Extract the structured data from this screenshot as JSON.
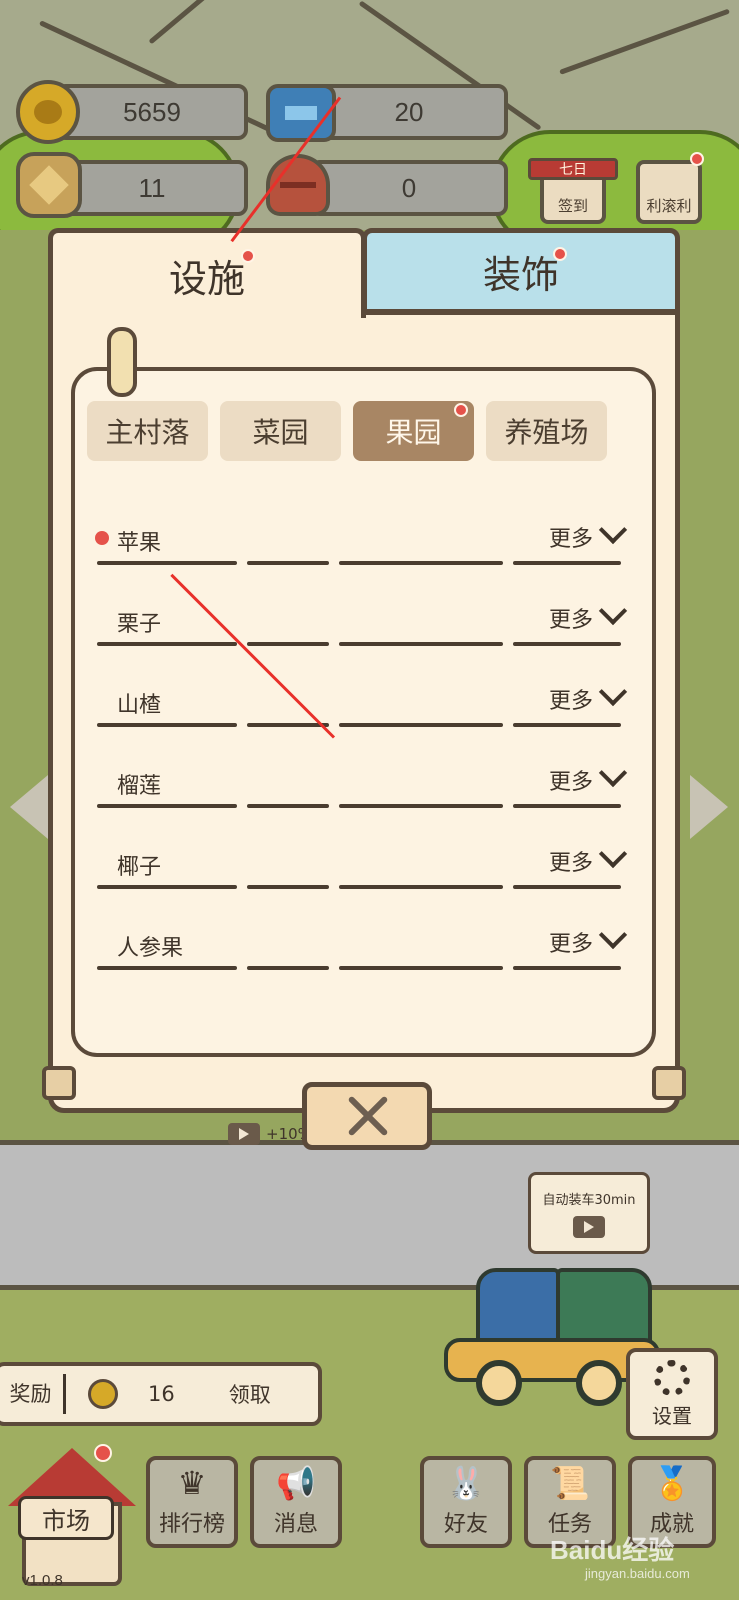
{
  "resources": {
    "coins": "5659",
    "gems": "20",
    "stars": "11",
    "shells": "0"
  },
  "side_buttons": {
    "checkin_top": "七日",
    "checkin": "签到",
    "rolling": "利滚利"
  },
  "dialog": {
    "tabs": [
      {
        "label": "设施",
        "active": true,
        "has_notice": true
      },
      {
        "label": "装饰",
        "active": false,
        "has_notice": true
      }
    ],
    "sub_tabs": [
      {
        "label": "主村落",
        "active": false
      },
      {
        "label": "菜园",
        "active": false
      },
      {
        "label": "果园",
        "active": true,
        "has_notice": true
      },
      {
        "label": "养殖场",
        "active": false
      }
    ],
    "more_label": "更多",
    "items": [
      {
        "name": "苹果",
        "has_notice": true
      },
      {
        "name": "栗子"
      },
      {
        "name": "山楂"
      },
      {
        "name": "榴莲"
      },
      {
        "name": "椰子"
      },
      {
        "name": "人参果"
      }
    ]
  },
  "ad_chip": {
    "text": "+10%"
  },
  "auto_load": {
    "label": "自动装车30min"
  },
  "reward_bar": {
    "label": "奖励",
    "count": "16",
    "claim": "领取"
  },
  "settings": {
    "label": "设置"
  },
  "bottom_nav": {
    "market": "市场",
    "leaderboard": "排行榜",
    "messages": "消息",
    "friends": "好友",
    "tasks": "任务",
    "achievements": "成就"
  },
  "version": "v1.0.8",
  "watermark": {
    "main": "Baidu经验",
    "sub": "jingyan.baidu.com"
  },
  "colors": {
    "accent_red": "#e5524a",
    "panel_cream": "#fcefd9",
    "tab_blue": "#b9e0ea",
    "active_subtab": "#a88664",
    "outline": "#5b4a3a"
  },
  "icons": [
    "coin-icon",
    "gem-icon",
    "star-icon",
    "shell-icon",
    "chevron-down-icon",
    "close-icon",
    "play-icon",
    "gear-icon"
  ]
}
